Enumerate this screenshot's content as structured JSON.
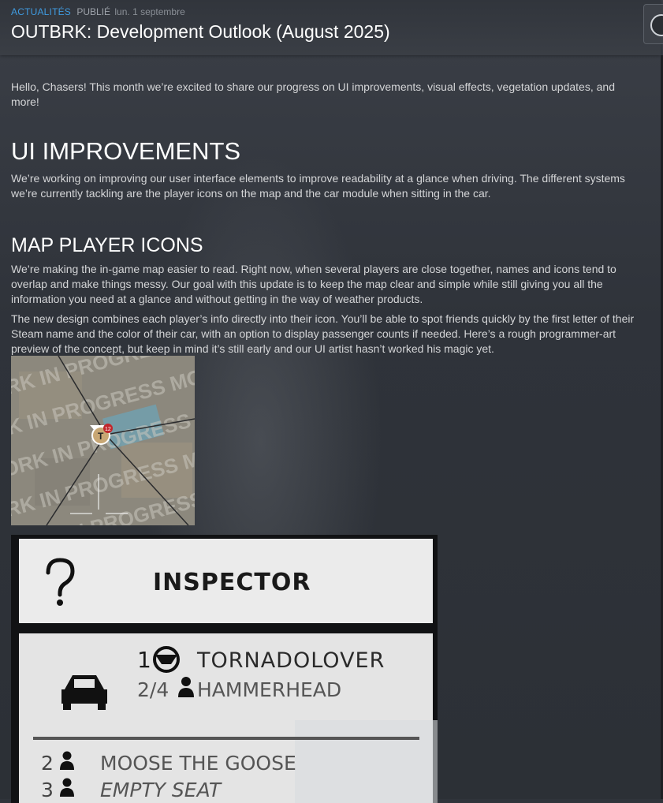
{
  "header": {
    "category": "ACTUALITÉS",
    "published_label": "PUBLIÉ",
    "date": "lun. 1 septembre",
    "title": "OUTBRK: Development Outlook (August 2025)"
  },
  "article": {
    "intro": "Hello, Chasers! This month we’re excited to share our progress on UI improvements, visual effects, vegetation updates, and more!",
    "section1": {
      "heading": "UI IMPROVEMENTS",
      "body": "We’re working on improving our user interface elements to improve readability at a glance when driving. The different systems we’re currently tackling are the player icons on the map and the car module when sitting in the car."
    },
    "section2": {
      "heading": "MAP PLAYER ICONS",
      "body1": "We’re making the in-game map easier to read. Right now, when several players are close together, names and icons tend to overlap and make things messy. Our goal with this update is to keep the map clear and simple while still giving you all the information you need at a glance and without getting in the way of weather products.",
      "body2": "The new design combines each player’s info directly into their icon. You’ll be able to spot friends quickly by the first letter of their Steam name and the color of their car, with an option to display passenger counts if needed. Here’s a rough programmer-art preview of the concept, but keep in mind it’s still early and our UI artist hasn’t worked his magic yet."
    }
  },
  "map_preview": {
    "watermark": "WORK IN PROGRESS MOCKUP",
    "badge": "12",
    "icons": [
      "map-player-icon"
    ]
  },
  "inspector": {
    "title": "INSPECTOR",
    "driver_index": "1",
    "driver_name": "TORNADOLOVER",
    "car_seats": "2/4",
    "car_name": "HAMMERHEAD",
    "seats": [
      {
        "index": "2",
        "name": "MOOSE THE GOOSE"
      },
      {
        "index": "3",
        "name": "EMPTY SEAT"
      }
    ],
    "icons": [
      "question-mark-icon",
      "car-icon",
      "steering-wheel-icon",
      "person-icon"
    ]
  },
  "colors": {
    "accent": "#3f9be0",
    "title": "#ffffff",
    "body": "#d4d5d7",
    "panel": "#ebebeb"
  }
}
